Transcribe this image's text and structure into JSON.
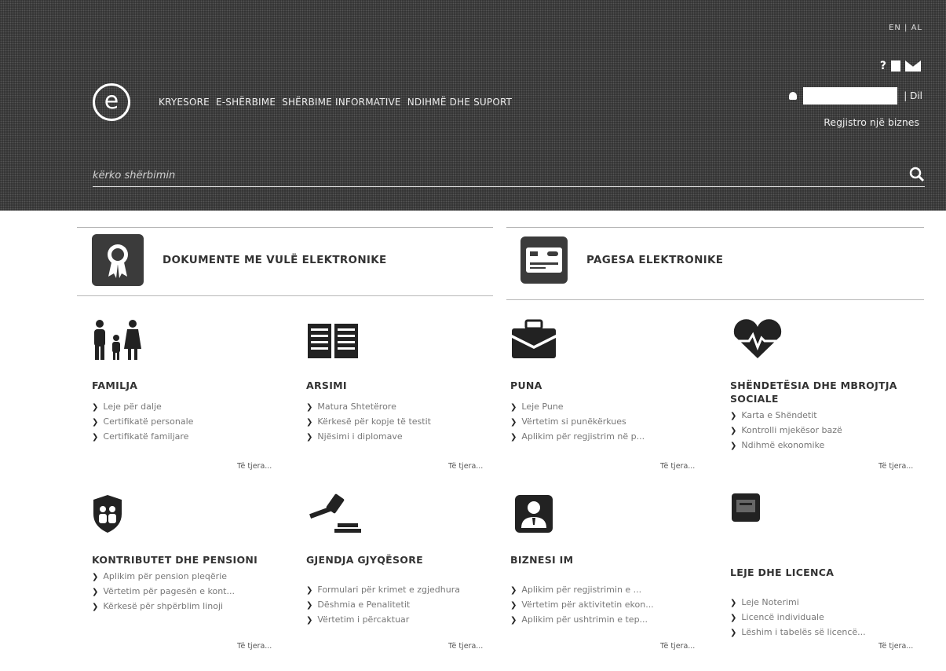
{
  "header": {
    "lang": "EN | AL",
    "logo_letter": "e",
    "nav": [
      "KRYESORE",
      "E-SHËRBIME",
      "SHËRBIME INFORMATIVE",
      "NDIHMË DHE SUPORT"
    ],
    "logout": "| Dil",
    "register": "Regjistro një biznes",
    "search_placeholder": "kërko shërbimin"
  },
  "featured": [
    {
      "label": "DOKUMENTE ME VULË ELEKTRONIKE",
      "icon": "certificate-seal-icon"
    },
    {
      "label": "PAGESA ELEKTRONIKE",
      "icon": "payment-card-icon"
    }
  ],
  "categories": [
    {
      "title": "FAMILJA",
      "icon": "family-icon",
      "links": [
        "Leje për dalje",
        "Certifikatë personale",
        "Certifikatë familjare"
      ],
      "more": "Të tjera..."
    },
    {
      "title": "ARSIMI",
      "icon": "book-icon",
      "links": [
        "Matura Shtetërore",
        "Kërkesë për kopje të testit",
        "Njësimi i diplomave"
      ],
      "more": "Të tjera..."
    },
    {
      "title": "PUNA",
      "icon": "briefcase-icon",
      "links": [
        "Leje Pune",
        "Vërtetim si punëkërkues",
        "Aplikim për regjistrim në p..."
      ],
      "more": "Të tjera..."
    },
    {
      "title": "SHËNDETËSIA DHE MBROJTJA SOCIALE",
      "icon": "heart-pulse-icon",
      "links": [
        "Karta e Shëndetit",
        "Kontrolli mjekësor bazë",
        "Ndihmë ekonomike"
      ],
      "more": "Të tjera..."
    },
    {
      "title": "KONTRIBUTET DHE PENSIONI",
      "icon": "shield-family-icon",
      "links": [
        "Aplikim për pension pleqërie",
        "Vërtetim për pagesën e kont...",
        "Kërkesë për shpërblim linoji"
      ],
      "more": "Të tjera..."
    },
    {
      "title": "GJENDJA GJYQËSORE",
      "icon": "gavel-icon",
      "links": [
        "Formulari për krimet e zgjedhura",
        "Dëshmia e Penalitetit",
        "Vërtetim i përcaktuar"
      ],
      "more": "Të tjera..."
    },
    {
      "title": "BIZNESI IM",
      "icon": "business-person-icon",
      "links": [
        "Aplikim për regjistrimin e ...",
        "Vërtetim për aktivitetin ekon...",
        "Aplikim për ushtrimin e tep..."
      ],
      "more": "Të tjera..."
    },
    {
      "title": "LEJE DHE LICENCA",
      "icon": "license-document-icon",
      "links": [
        "Leje Noterimi",
        "Licencë individuale",
        "Lëshim i tabelës së licencë..."
      ],
      "more": "Të tjera..."
    }
  ]
}
